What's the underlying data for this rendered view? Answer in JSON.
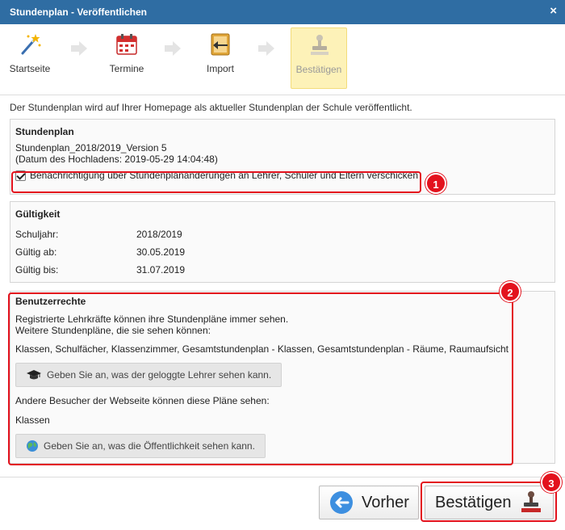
{
  "dialog": {
    "title": "Stundenplan - Veröffentlichen",
    "close_glyph": "×"
  },
  "wizard": {
    "steps": [
      {
        "label": "Startseite",
        "icon": "magic-wand-icon"
      },
      {
        "label": "Termine",
        "icon": "calendar-icon"
      },
      {
        "label": "Import",
        "icon": "import-icon"
      },
      {
        "label": "Bestätigen",
        "icon": "stamp-icon",
        "active": true
      }
    ]
  },
  "intro": "Der Stundenplan wird auf Ihrer Homepage als aktueller Stundenplan der Schule veröffentlicht.",
  "stundenplan": {
    "title": "Stundenplan",
    "name": "Stundenplan_2018/2019_Version 5",
    "upload_date": "(Datum des Hochladens: 2019-05-29 14:04:48)",
    "notify_label": "Benachrichtigung über Stundenplanänderungen an Lehrer, Schüler und Eltern verschicken",
    "notify_checked": true
  },
  "gueltigkeit": {
    "title": "Gültigkeit",
    "rows": [
      {
        "label": "Schuljahr:",
        "value": "2018/2019"
      },
      {
        "label": "Gültig ab:",
        "value": "30.05.2019"
      },
      {
        "label": "Gültig bis:",
        "value": "31.07.2019"
      }
    ]
  },
  "benutzerrechte": {
    "title": "Benutzerrechte",
    "line1": "Registrierte Lehrkräfte können ihre Stundenpläne immer sehen.",
    "line2": "Weitere Stundenpläne, die sie sehen können:",
    "teacher_plans": "Klassen, Schulfächer, Klassenzimmer, Gesamtstundenplan - Klassen, Gesamtstundenplan - Räume, Raumaufsicht",
    "teacher_button": "Geben Sie an, was der geloggte Lehrer sehen kann.",
    "visitors_line": "Andere Besucher der Webseite können diese Pläne sehen:",
    "visitor_plans": "Klassen",
    "public_button": "Geben Sie an, was die Öffentlichkeit sehen kann."
  },
  "footer": {
    "back_label": "Vorher",
    "confirm_label": "Bestätigen"
  },
  "annotations": {
    "badge1": "1",
    "badge2": "2",
    "badge3": "3"
  },
  "colors": {
    "titlebar": "#2f6da3",
    "highlight": "#e3121d",
    "active_step": "#fdf2b8"
  }
}
